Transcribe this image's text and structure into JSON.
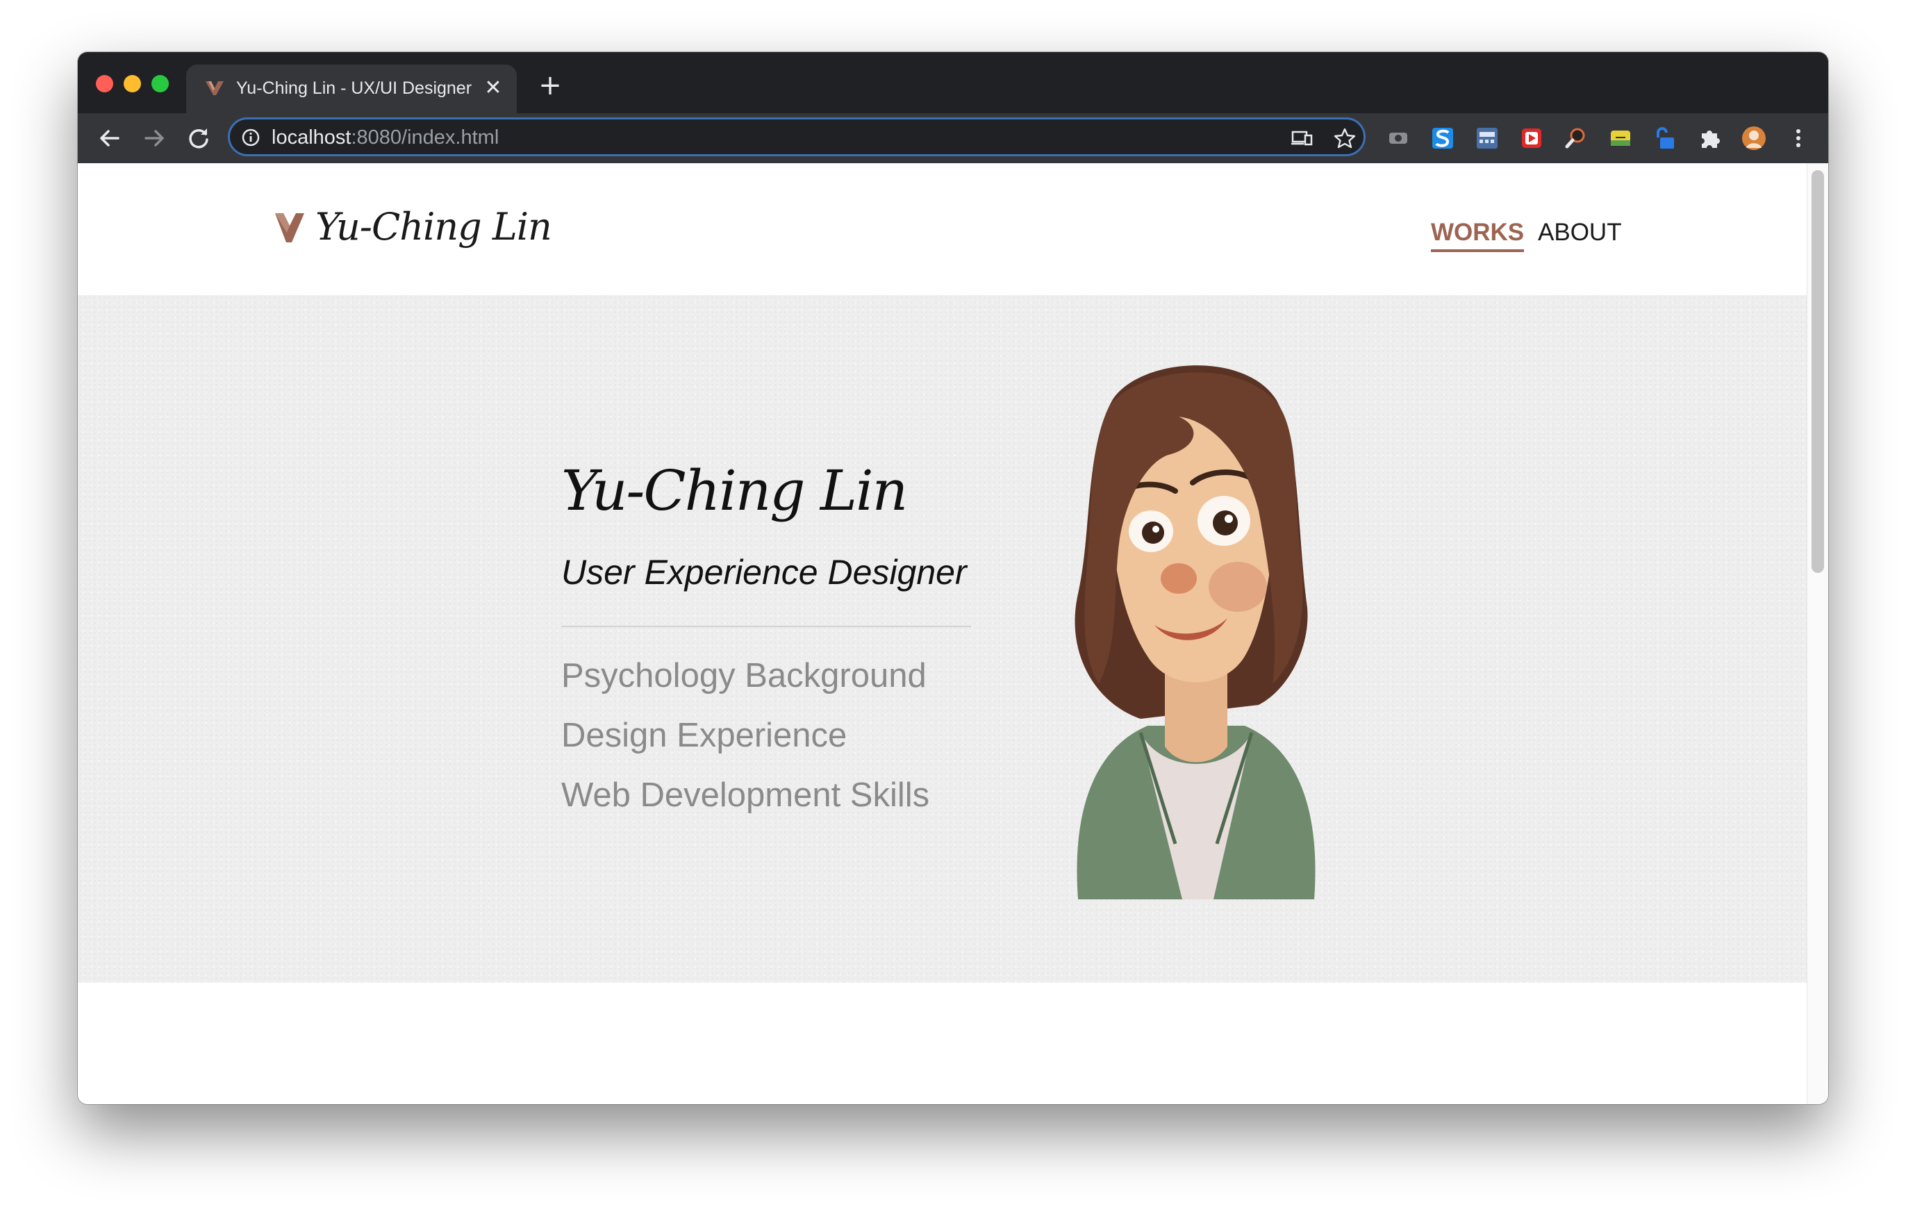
{
  "browser": {
    "tab_title": "Yu-Ching Lin - UX/UI Designer",
    "close_glyph": "✕",
    "newtab_glyph": "+",
    "url_host": "localhost",
    "url_rest": ":8080/index.html",
    "accent_color": "#3c6fb4",
    "extensions": [
      "screencast-icon",
      "s-extension-icon",
      "mix-extension-icon",
      "video-extension-icon",
      "search-extension-icon",
      "pencil-extension-icon",
      "lock-extension-icon",
      "puzzle-icon",
      "profile-avatar",
      "menu-dots-icon"
    ]
  },
  "site": {
    "logo_text": "Yu-Ching Lin",
    "brand_color": "#9c6452",
    "nav": {
      "works": "WORKS",
      "about": "ABOUT"
    }
  },
  "hero": {
    "name": "Yu-Ching Lin",
    "role": "User Experience Designer",
    "skills": [
      "Psychology Background",
      "Design Experience",
      "Web Development Skills"
    ]
  }
}
